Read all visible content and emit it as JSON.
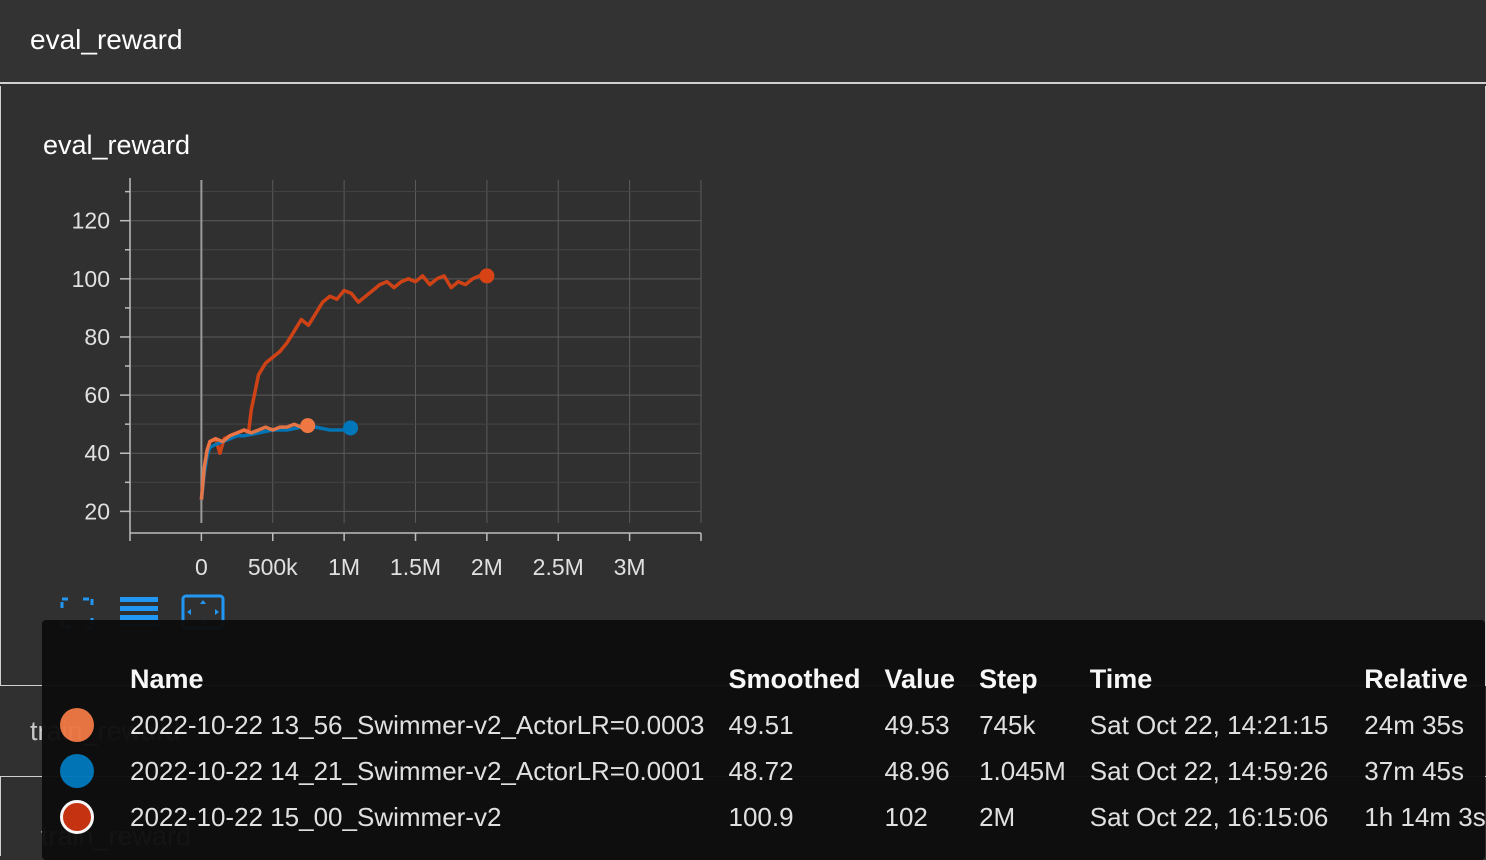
{
  "header": {
    "title": "eval_reward"
  },
  "card": {
    "title": "eval_reward"
  },
  "next_card": {
    "title": "train_reward"
  },
  "chart_data": {
    "type": "line",
    "title": "",
    "xlabel": "",
    "ylabel": "",
    "xlim": [
      -500000,
      3500000
    ],
    "ylim": [
      16,
      134
    ],
    "x_ticks": [
      0,
      500000,
      1000000,
      1500000,
      2000000,
      2500000,
      3000000
    ],
    "x_tick_labels": [
      "0",
      "500k",
      "1M",
      "1.5M",
      "2M",
      "2.5M",
      "3M"
    ],
    "y_ticks": [
      20,
      40,
      60,
      80,
      100,
      120
    ],
    "y_tick_labels": [
      "20",
      "40",
      "60",
      "80",
      "100",
      "120"
    ],
    "grid": true,
    "series": [
      {
        "name": "2022-10-22 15_00_Swimmer-v2",
        "color": "#d84315",
        "x": [
          0,
          20000,
          40000,
          60000,
          100000,
          130000,
          160000,
          200000,
          250000,
          300000,
          330000,
          350000,
          380000,
          400000,
          450000,
          500000,
          550000,
          600000,
          650000,
          700000,
          750000,
          800000,
          850000,
          900000,
          950000,
          1000000,
          1050000,
          1100000,
          1150000,
          1200000,
          1250000,
          1300000,
          1350000,
          1400000,
          1450000,
          1500000,
          1550000,
          1600000,
          1650000,
          1700000,
          1750000,
          1800000,
          1850000,
          1900000,
          1950000,
          2000000
        ],
        "values": [
          24,
          33,
          41,
          44,
          45,
          40,
          45,
          46,
          47,
          48,
          47,
          55,
          62,
          67,
          71,
          73,
          75,
          78,
          82,
          86,
          84,
          88,
          92,
          94,
          93,
          96,
          95,
          92,
          94,
          96,
          98,
          99,
          97,
          99,
          100,
          99,
          101,
          98,
          100,
          101,
          97,
          99,
          98,
          100,
          101,
          101
        ]
      },
      {
        "name": "2022-10-22 14_21_Swimmer-v2_ActorLR=0.0001",
        "color": "#0077bb",
        "x": [
          0,
          20000,
          40000,
          60000,
          100000,
          150000,
          200000,
          250000,
          300000,
          400000,
          500000,
          600000,
          700000,
          800000,
          900000,
          1000000,
          1045000
        ],
        "values": [
          24,
          33,
          39,
          42,
          43,
          44,
          45,
          46,
          46,
          47,
          48,
          48,
          49,
          49,
          48,
          48,
          48.7
        ]
      },
      {
        "name": "2022-10-22 13_56_Swimmer-v2_ActorLR=0.0003",
        "color": "#ee7744",
        "x": [
          0,
          20000,
          40000,
          60000,
          100000,
          150000,
          200000,
          250000,
          300000,
          350000,
          400000,
          450000,
          500000,
          550000,
          600000,
          650000,
          700000,
          745000
        ],
        "values": [
          24,
          35,
          41,
          44,
          45,
          44,
          46,
          47,
          48,
          47,
          48,
          49,
          48,
          49,
          49,
          50,
          49,
          49.5
        ]
      }
    ]
  },
  "toolbar": {
    "fullscreen_icon": "fullscreen-icon",
    "data_icon": "data-table-icon",
    "fit_icon": "fit-domain-icon"
  },
  "tooltip": {
    "headers": {
      "name": "Name",
      "smoothed": "Smoothed",
      "value": "Value",
      "step": "Step",
      "time": "Time",
      "relative": "Relative"
    },
    "rows": [
      {
        "color": "#ee7744",
        "outlined": false,
        "name": "2022-10-22 13_56_Swimmer-v2_ActorLR=0.0003",
        "smoothed": "49.51",
        "value": "49.53",
        "step": "745k",
        "time": "Sat Oct 22, 14:21:15",
        "relative": "24m 35s"
      },
      {
        "color": "#0077bb",
        "outlined": false,
        "name": "2022-10-22 14_21_Swimmer-v2_ActorLR=0.0001",
        "smoothed": "48.72",
        "value": "48.96",
        "step": "1.045M",
        "time": "Sat Oct 22, 14:59:26",
        "relative": "37m 45s"
      },
      {
        "color": "#cc3311",
        "outlined": true,
        "name": "2022-10-22 15_00_Swimmer-v2",
        "smoothed": "100.9",
        "value": "102",
        "step": "2M",
        "time": "Sat Oct 22, 16:15:06",
        "relative": "1h 14m 3s"
      }
    ]
  }
}
